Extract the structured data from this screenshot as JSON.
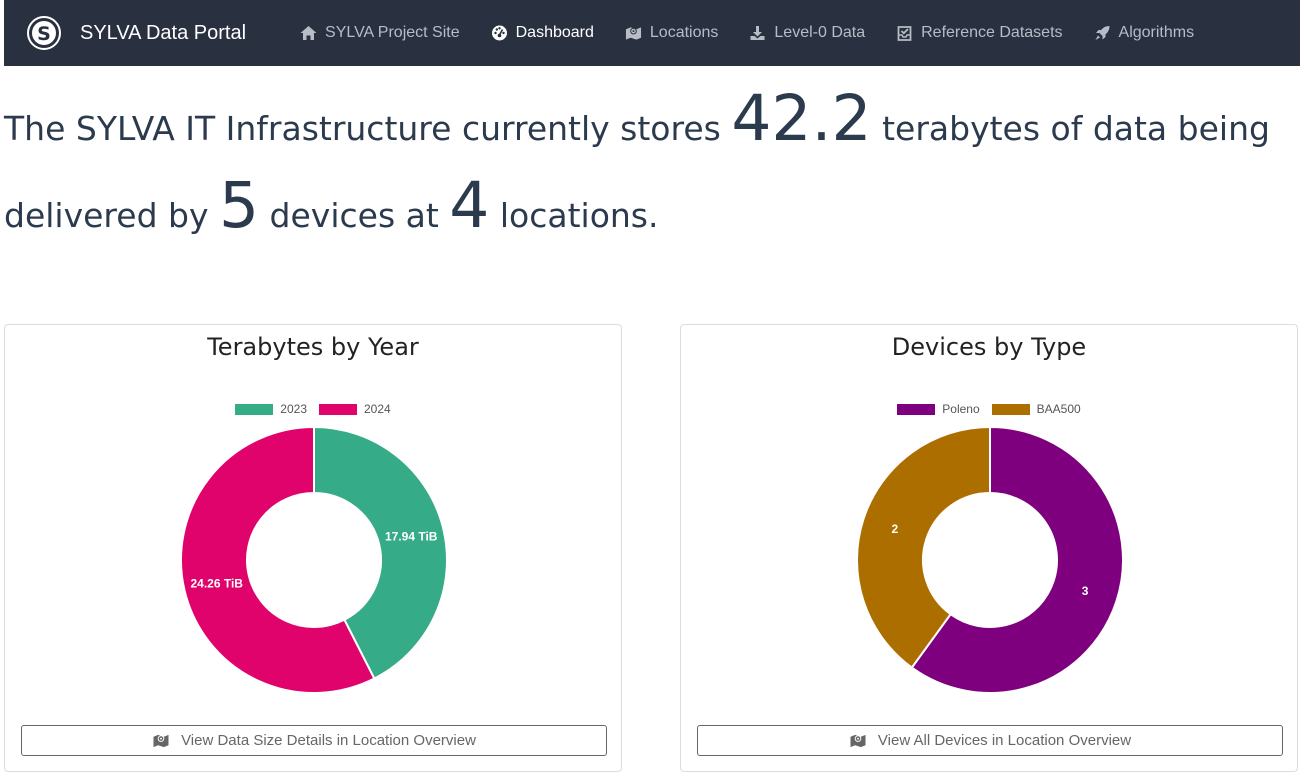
{
  "navbar": {
    "brand": "SYLVA Data Portal",
    "items": [
      {
        "label": "SYLVA Project Site",
        "icon": "home-icon"
      },
      {
        "label": "Dashboard",
        "icon": "dashboard-icon",
        "active": true
      },
      {
        "label": "Locations",
        "icon": "map-icon"
      },
      {
        "label": "Level-0 Data",
        "icon": "download-icon"
      },
      {
        "label": "Reference Datasets",
        "icon": "inbox-check-icon"
      },
      {
        "label": "Algorithms",
        "icon": "rocket-icon"
      }
    ]
  },
  "headline": {
    "part1": "The SYLVA IT Infrastructure currently stores ",
    "terabytes": "42.2",
    "part2": " terabytes of data being delivered by ",
    "devices": "5",
    "part3": " devices at ",
    "locations": "4",
    "part4": " locations."
  },
  "cards": {
    "terabytes": {
      "title": "Terabytes by Year",
      "button_label": "View Data Size Details in Location Overview"
    },
    "devices": {
      "title": "Devices by Type",
      "button_label": "View All Devices in Location Overview"
    }
  },
  "chart_data": [
    {
      "type": "pie",
      "title": "Terabytes by Year",
      "categories": [
        "2023",
        "2024"
      ],
      "values": [
        17.94,
        24.26
      ],
      "labels": [
        "17.94 TiB",
        "24.26 TiB"
      ],
      "colors": [
        "#36ab87",
        "#e0036c"
      ],
      "legend": "top"
    },
    {
      "type": "pie",
      "title": "Devices by Type",
      "categories": [
        "Poleno",
        "BAA500"
      ],
      "values": [
        3,
        2
      ],
      "labels": [
        "3",
        "2"
      ],
      "colors": [
        "#7f007f",
        "#ad6e00"
      ],
      "legend": "top"
    }
  ]
}
